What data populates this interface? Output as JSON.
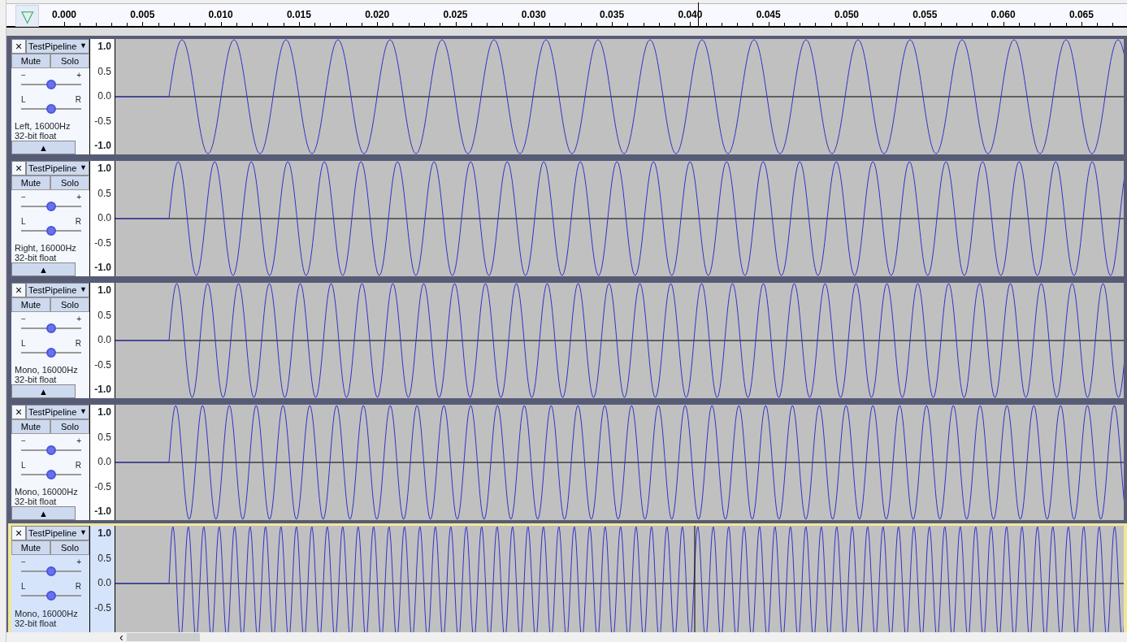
{
  "ruler": {
    "play_button": "▽",
    "ticks": [
      "0.000",
      "0.005",
      "0.010",
      "0.015",
      "0.020",
      "0.025",
      "0.030",
      "0.035",
      "0.040",
      "0.045",
      "0.050",
      "0.055",
      "0.060",
      "0.065"
    ]
  },
  "tracks": [
    {
      "close": "×",
      "name": "TestPipeline",
      "menu_caret": "▼",
      "mute": "Mute",
      "solo": "Solo",
      "gain_min": "−",
      "gain_max": "+",
      "gain": {
        "level": 0.5
      },
      "pan_left": "L",
      "pan_right": "R",
      "pan": {
        "level": 0.5
      },
      "info": [
        "Left, 16000Hz",
        "32-bit float"
      ],
      "collapse": "▲",
      "scale": [
        "1.0",
        "0.5",
        "0.0",
        "-0.5",
        "-1.0"
      ],
      "selected": false
    },
    {
      "close": "×",
      "name": "TestPipeline",
      "menu_caret": "▼",
      "mute": "Mute",
      "solo": "Solo",
      "gain_min": "−",
      "gain_max": "+",
      "gain": {
        "level": 0.5
      },
      "pan_left": "L",
      "pan_right": "R",
      "pan": {
        "level": 0.5
      },
      "info": [
        "Right, 16000Hz",
        "32-bit float"
      ],
      "collapse": "▲",
      "scale": [
        "1.0",
        "0.5",
        "0.0",
        "-0.5",
        "-1.0"
      ],
      "selected": false
    },
    {
      "close": "×",
      "name": "TestPipeline",
      "menu_caret": "▼",
      "mute": "Mute",
      "solo": "Solo",
      "gain_min": "−",
      "gain_max": "+",
      "gain": {
        "level": 0.5
      },
      "pan_left": "L",
      "pan_right": "R",
      "pan": {
        "level": 0.5
      },
      "info": [
        "Mono, 16000Hz",
        "32-bit float"
      ],
      "collapse": "▲",
      "scale": [
        "1.0",
        "0.5",
        "0.0",
        "-0.5",
        "-1.0"
      ],
      "selected": false
    },
    {
      "close": "×",
      "name": "TestPipeline",
      "menu_caret": "▼",
      "mute": "Mute",
      "solo": "Solo",
      "gain_min": "−",
      "gain_max": "+",
      "gain": {
        "level": 0.5
      },
      "pan_left": "L",
      "pan_right": "R",
      "pan": {
        "level": 0.5
      },
      "info": [
        "Mono, 16000Hz",
        "32-bit float"
      ],
      "collapse": "▲",
      "scale": [
        "1.0",
        "0.5",
        "0.0",
        "-0.5",
        "-1.0"
      ],
      "selected": false
    },
    {
      "close": "×",
      "name": "TestPipeline",
      "menu_caret": "▼",
      "mute": "Mute",
      "solo": "Solo",
      "gain_min": "−",
      "gain_max": "+",
      "gain": {
        "level": 0.5
      },
      "pan_left": "L",
      "pan_right": "R",
      "pan": {
        "level": 0.5
      },
      "info": [
        "Mono, 16000Hz",
        "32-bit float"
      ],
      "scale": [
        "1.0",
        "0.5",
        "0.0",
        "-0.5"
      ],
      "selected": true
    }
  ],
  "scrollbar": {
    "left_arrow": "‹"
  }
}
